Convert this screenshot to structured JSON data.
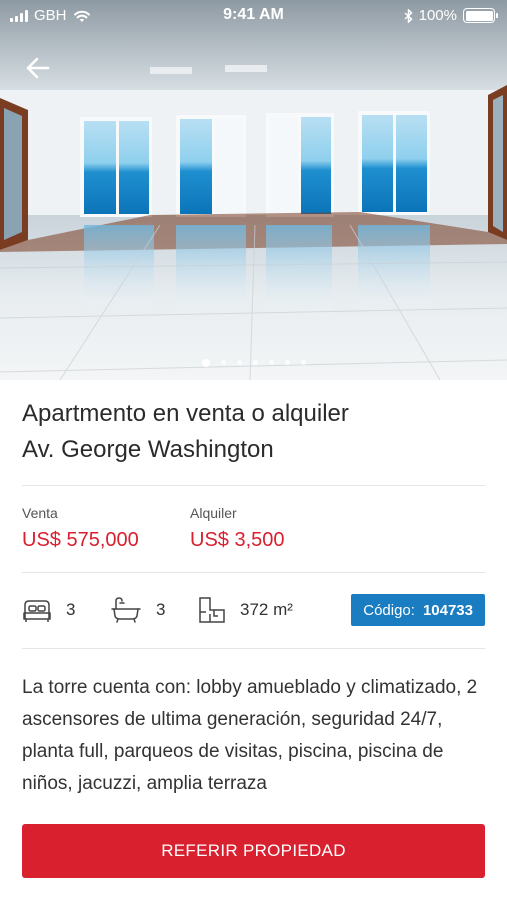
{
  "status_bar": {
    "carrier": "GBH",
    "time": "9:41 AM",
    "battery": "100%"
  },
  "gallery": {
    "image_alt": "empty apartment living room with ocean view windows",
    "page_count": 7,
    "active_page": 1
  },
  "listing": {
    "title_line1": "Apartmento en venta o alquiler",
    "title_line2": "Av. George Washington"
  },
  "prices": {
    "sale_label": "Venta",
    "sale_value": "US$ 575,000",
    "rent_label": "Alquiler",
    "rent_value": "US$ 3,500"
  },
  "features": {
    "bedrooms": "3",
    "bathrooms": "3",
    "area": "372 m²",
    "code_label": "Código:",
    "code_value": "104733"
  },
  "description": "La torre cuenta con: lobby amueblado y climatizado, 2 ascensores de ultima generación, seguridad 24/7, planta full, parqueos de visitas, piscina, piscina de niños, jacuzzi, amplia terraza",
  "cta": {
    "label": "REFERIR PROPIEDAD"
  },
  "colors": {
    "accent_red": "#d9202f",
    "badge_blue": "#1a7cc1"
  },
  "icons": [
    "wifi-icon",
    "bluetooth-icon",
    "battery-icon",
    "back-arrow-icon",
    "bed-icon",
    "bathtub-icon",
    "floorplan-icon"
  ]
}
